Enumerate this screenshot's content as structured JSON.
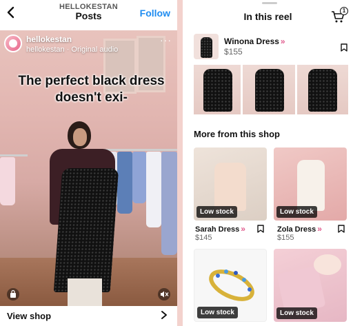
{
  "left": {
    "header": {
      "account_title": "HELLOKESTAN",
      "subtitle": "Posts",
      "follow_label": "Follow"
    },
    "reel": {
      "account_name": "hellokestan",
      "audio_line": "hellokestan · Original audio",
      "more_glyph": "···",
      "caption": "The perfect black dress doesn't exi-"
    },
    "view_shop_label": "View shop"
  },
  "right": {
    "title": "In this reel",
    "cart_count": "1",
    "featured": {
      "name": "Winona Dress",
      "chevrons": "»",
      "price": "$155"
    },
    "section_title": "More from this shop",
    "products": [
      {
        "badge": "Low stock",
        "name": "Sarah Dress",
        "chevrons": "»",
        "price": "$145"
      },
      {
        "badge": "Low stock",
        "name": "Zola Dress",
        "chevrons": "»",
        "price": "$155"
      },
      {
        "badge": "Low stock"
      },
      {
        "badge": "Low stock"
      }
    ]
  },
  "colors": {
    "follow": "#1f8cf0",
    "background": "#f3d2cd",
    "accent": "#e05b8d",
    "badge": "#000000"
  }
}
